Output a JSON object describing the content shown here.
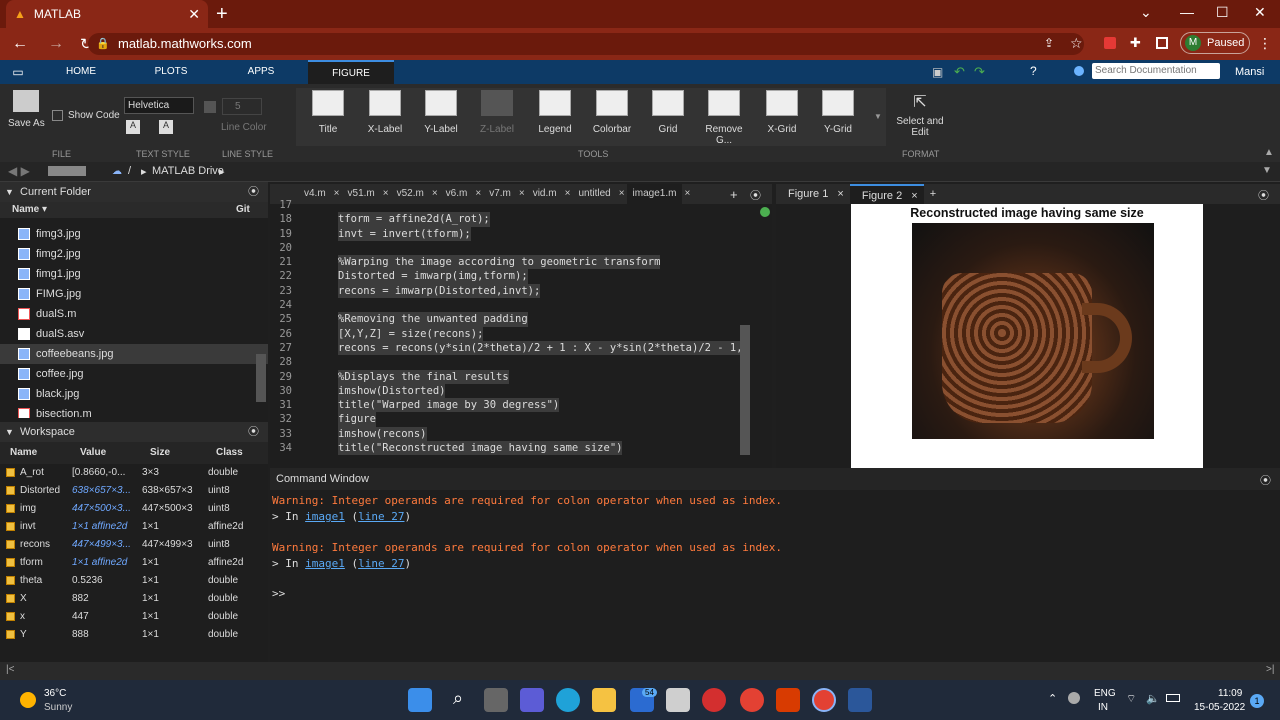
{
  "browser": {
    "tab_title": "MATLAB",
    "url": "matlab.mathworks.com",
    "profile_initial": "M",
    "profile_status": "Paused"
  },
  "matlab": {
    "tabs": [
      "HOME",
      "PLOTS",
      "APPS",
      "FIGURE"
    ],
    "search_placeholder": "Search Documentation",
    "user": "Mansi",
    "toolstrip": {
      "save_as": "Save As",
      "show_code": "Show Code",
      "font": "Helvetica",
      "line_width": "5",
      "line_color": "Line Color",
      "sections": {
        "file": "FILE",
        "text_style": "TEXT STYLE",
        "line_style": "LINE STYLE",
        "tools": "TOOLS",
        "format": "FORMAT"
      },
      "tools": [
        "Title",
        "X-Label",
        "Y-Label",
        "Z-Label",
        "Legend",
        "Colorbar",
        "Grid",
        "Remove G...",
        "X-Grid",
        "Y-Grid"
      ],
      "select_edit": "Select and Edit"
    },
    "address": {
      "root": "/",
      "folder": "MATLAB Drive"
    },
    "current_folder": {
      "title": "Current Folder",
      "col_name": "Name ▾",
      "col_git": "Git",
      "files": [
        "fimg3.jpg",
        "fimg2.jpg",
        "fimg1.jpg",
        "FIMG.jpg",
        "dualS.m",
        "dualS.asv",
        "coffeebeans.jpg",
        "coffee.jpg",
        "black.jpg",
        "bisection.m"
      ]
    },
    "workspace": {
      "title": "Workspace",
      "cols": [
        "Name",
        "Value",
        "Size",
        "Class"
      ],
      "rows": [
        [
          "A_rot",
          "[0.8660,-0...",
          "3×3",
          "double"
        ],
        [
          "Distorted",
          "638×657×3...",
          "638×657×3",
          "uint8"
        ],
        [
          "img",
          "447×500×3...",
          "447×500×3",
          "uint8"
        ],
        [
          "invt",
          "1×1 affine2d",
          "1×1",
          "affine2d"
        ],
        [
          "recons",
          "447×499×3...",
          "447×499×3",
          "uint8"
        ],
        [
          "tform",
          "1×1 affine2d",
          "1×1",
          "affine2d"
        ],
        [
          "theta",
          "0.5236",
          "1×1",
          "double"
        ],
        [
          "X",
          "882",
          "1×1",
          "double"
        ],
        [
          "x",
          "447",
          "1×1",
          "double"
        ],
        [
          "Y",
          "888",
          "1×1",
          "double"
        ]
      ]
    },
    "editor": {
      "tabs": [
        "v4.m",
        "v51.m",
        "v52.m",
        "v6.m",
        "v7.m",
        "vid.m",
        "untitled",
        "image1.m"
      ],
      "lines": [
        [
          "17",
          ""
        ],
        [
          "18",
          "tform = affine2d(A_rot);"
        ],
        [
          "19",
          "invt = invert(tform);"
        ],
        [
          "20",
          ""
        ],
        [
          "21",
          "%Warping the image according to geometric transform"
        ],
        [
          "22",
          "Distorted = imwarp(img,tform);"
        ],
        [
          "23",
          "recons = imwarp(Distorted,invt);"
        ],
        [
          "24",
          ""
        ],
        [
          "25",
          "%Removing the unwanted padding"
        ],
        [
          "26",
          "[X,Y,Z] = size(recons);"
        ],
        [
          "27",
          "recons = recons(y*sin(2*theta)/2 + 1 : X - y*sin(2*theta)/2 - 1,"
        ],
        [
          "28",
          ""
        ],
        [
          "29",
          "%Displays the final results"
        ],
        [
          "30",
          "imshow(Distorted)"
        ],
        [
          "31",
          "title(\"Warped image by 30 degress\")"
        ],
        [
          "32",
          "figure"
        ],
        [
          "33",
          "imshow(recons)"
        ],
        [
          "34",
          "title(\"Reconstructed image having same size\")"
        ]
      ]
    },
    "figures": {
      "tabs": [
        "Figure 1",
        "Figure 2"
      ],
      "plot_title": "Reconstructed image having same size"
    },
    "command_window": {
      "title": "Command Window",
      "warning": "Warning: Integer operands are required for colon operator when used as index.",
      "in_prefix": "> In ",
      "in_file": "image1",
      "in_line": "line 27",
      "prompt": ">>"
    }
  },
  "taskbar": {
    "temp": "36°C",
    "weather": "Sunny",
    "lang1": "ENG",
    "lang2": "IN",
    "time": "11:09",
    "date": "15-05-2022",
    "mail_badge": "54",
    "notif": "1"
  }
}
